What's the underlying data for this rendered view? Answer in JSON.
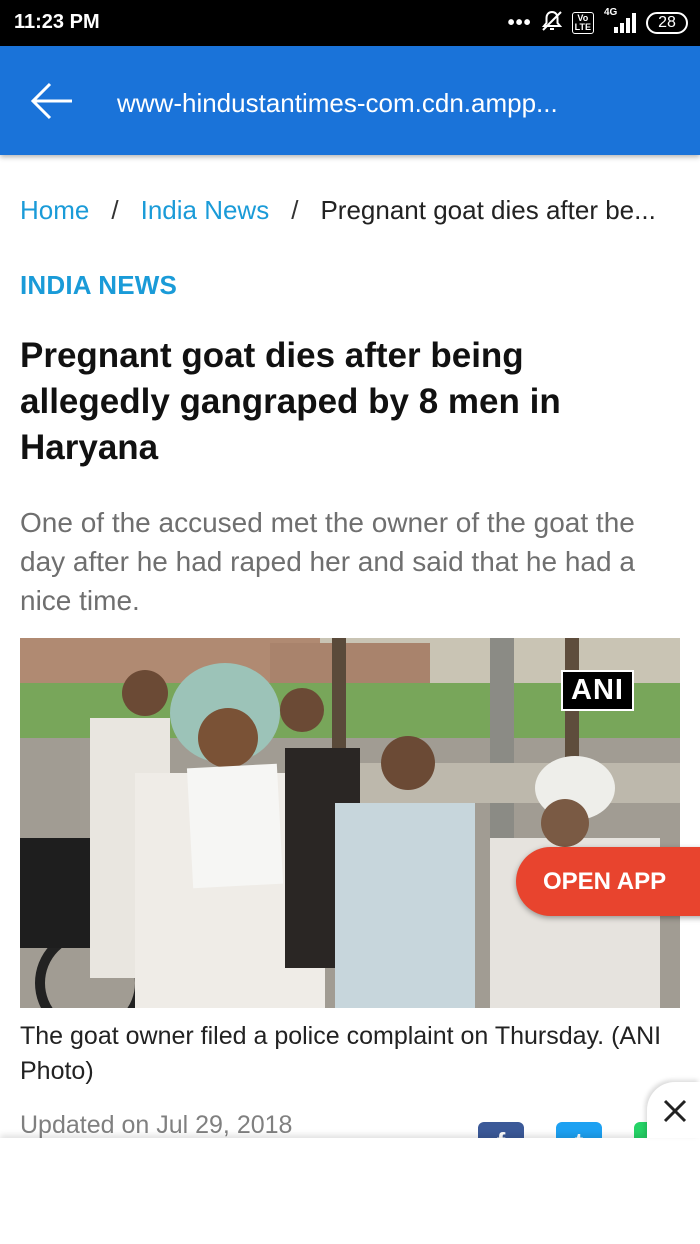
{
  "status_bar": {
    "time": "11:23 PM",
    "dots": "•••",
    "volte": "Vo LTE",
    "network": "4G",
    "battery": "28"
  },
  "app_bar": {
    "url": "www-hindustantimes-com.cdn.ampp..."
  },
  "breadcrumb": {
    "items": [
      "Home",
      "India News",
      "Pregnant goat dies after be..."
    ],
    "separator": "/"
  },
  "article": {
    "section": "INDIA NEWS",
    "headline": "Pregnant goat dies after being allegedly gangraped by 8 men in Haryana",
    "summary": "One of the accused met the owner of the goat the day after he had raped her and said that he had a nice time.",
    "image_badge": "ANI",
    "caption": "The goat owner filed a police complaint on Thursday. (ANI Photo)",
    "updated": "Updated on Jul 29, 2018"
  },
  "open_app": {
    "label": "OPEN APP",
    "color": "#e8442e"
  },
  "share": {
    "facebook_glyph": "f",
    "twitter_glyph": "t",
    "icons": [
      "facebook-icon",
      "twitter-icon",
      "whatsapp-icon"
    ]
  },
  "colors": {
    "app_bar": "#1a73d9",
    "link": "#1a9bd8"
  }
}
